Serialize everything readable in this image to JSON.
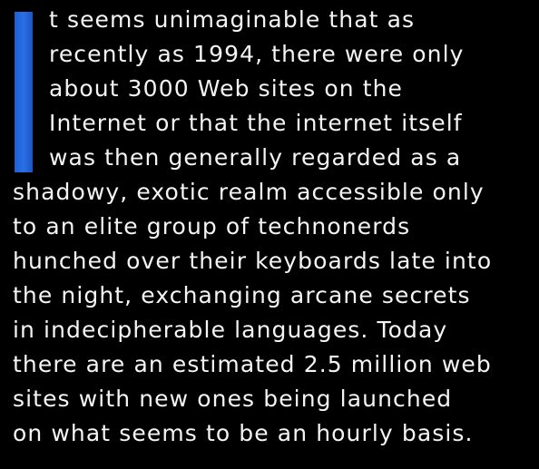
{
  "colors": {
    "background": "#000000",
    "text": "#f4f4f4",
    "dropcap": "#2a6fe6"
  },
  "paragraph": {
    "lines": [
      "t seems unimaginable that as",
      "recently as 1994, there were only",
      "about 3000 Web sites on the",
      "Internet  or that the internet itself",
      "was then generally regarded as a",
      "shadowy, exotic realm accessible only",
      "to an elite group of technonerds",
      "hunched over their keyboards late into",
      "the night, exchanging arcane secrets",
      "in indecipherable languages. Today",
      "there are an estimated 2.5 million web",
      "sites with new ones being launched",
      "on what seems to be an hourly basis."
    ]
  }
}
